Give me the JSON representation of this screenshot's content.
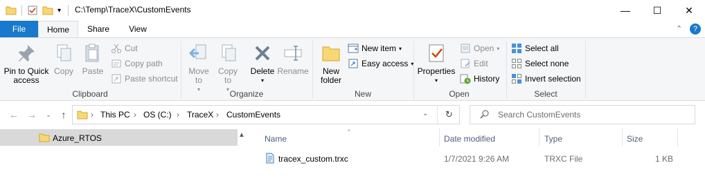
{
  "titlebar": {
    "path": "C:\\Temp\\TraceX\\CustomEvents",
    "minimize": "—",
    "maximize": "☐",
    "close": "✕"
  },
  "tabs": {
    "file": "File",
    "home": "Home",
    "share": "Share",
    "view": "View"
  },
  "ribbon": {
    "clipboard": {
      "pin": "Pin to Quick access",
      "copy": "Copy",
      "paste": "Paste",
      "cut": "Cut",
      "copy_path": "Copy path",
      "paste_shortcut": "Paste shortcut",
      "label": "Clipboard"
    },
    "organize": {
      "move_to": "Move to",
      "copy_to": "Copy to",
      "delete": "Delete",
      "rename": "Rename",
      "label": "Organize"
    },
    "new": {
      "new_folder": "New folder",
      "new_item": "New item",
      "easy_access": "Easy access",
      "label": "New"
    },
    "open": {
      "properties": "Properties",
      "open": "Open",
      "edit": "Edit",
      "history": "History",
      "label": "Open"
    },
    "select": {
      "select_all": "Select all",
      "select_none": "Select none",
      "invert": "Invert selection",
      "label": "Select"
    }
  },
  "address": {
    "crumbs": [
      "This PC",
      "OS (C:)",
      "TraceX",
      "CustomEvents"
    ],
    "search_placeholder": "Search CustomEvents"
  },
  "nav": {
    "items": [
      "Azure_RTOS"
    ]
  },
  "list": {
    "columns": [
      "Name",
      "Date modified",
      "Type",
      "Size"
    ],
    "rows": [
      {
        "name": "tracex_custom.trxc",
        "date": "1/7/2021 9:26 AM",
        "type": "TRXC File",
        "size": "1 KB"
      }
    ]
  },
  "colors": {
    "file_tab": "#1979ca",
    "ribbon_bg": "#f5f6f7",
    "nav_selected": "#d9d9d9",
    "folder_yellow": "#f8d775"
  }
}
